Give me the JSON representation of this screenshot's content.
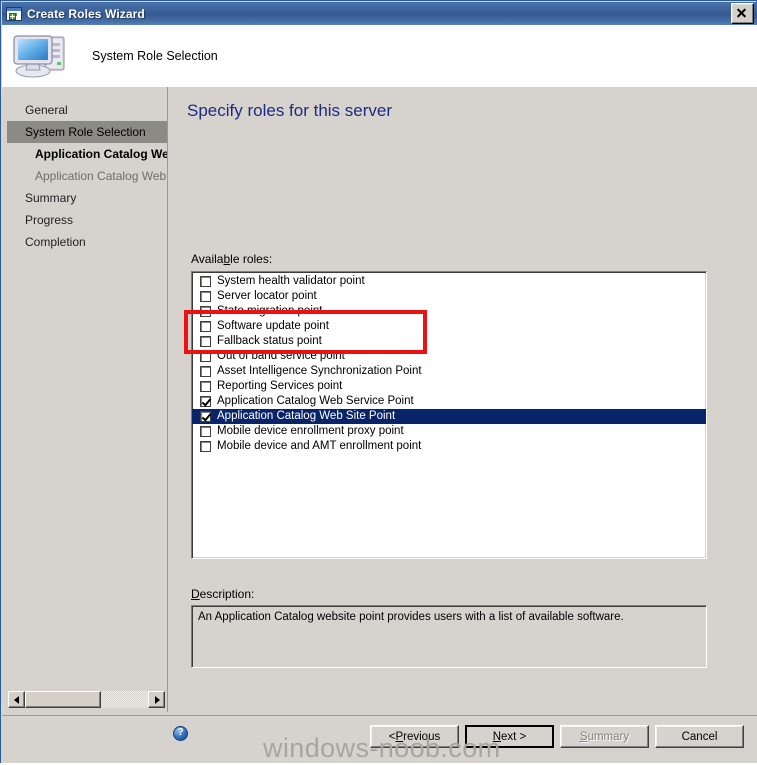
{
  "window": {
    "title": "Create Roles Wizard",
    "icon": "wizard-window-icon",
    "close_label": "Close"
  },
  "header": {
    "title": "System Role Selection",
    "icon": "computer-icon"
  },
  "sidebar": {
    "items": [
      {
        "label": "General",
        "state": "normal",
        "level": 0
      },
      {
        "label": "System Role Selection",
        "state": "selected",
        "level": 0
      },
      {
        "label": "Application Catalog Web Se",
        "state": "active",
        "level": 1
      },
      {
        "label": "Application Catalog Web Sit",
        "state": "dim",
        "level": 1
      },
      {
        "label": "Summary",
        "state": "normal",
        "level": 0
      },
      {
        "label": "Progress",
        "state": "normal",
        "level": 0
      },
      {
        "label": "Completion",
        "state": "normal",
        "level": 0
      }
    ],
    "scrollbar": {
      "left_arrow": "scroll-left",
      "right_arrow": "scroll-right"
    }
  },
  "content": {
    "heading": "Specify roles for this server",
    "roles_label_pre": "Availa",
    "roles_label_accel": "b",
    "roles_label_post": "le roles:",
    "description_label_accel": "D",
    "description_label_post": "escription:",
    "description_text": "An Application Catalog website point provides users with a list of available software.",
    "roles": [
      {
        "label": "System health validator point",
        "checked": false,
        "selected": false
      },
      {
        "label": "Server locator point",
        "checked": false,
        "selected": false
      },
      {
        "label": "State migration point",
        "checked": false,
        "selected": false
      },
      {
        "label": "Software update point",
        "checked": false,
        "selected": false
      },
      {
        "label": "Fallback status point",
        "checked": false,
        "selected": false
      },
      {
        "label": "Out of band service point",
        "checked": false,
        "selected": false
      },
      {
        "label": "Asset Intelligence Synchronization Point",
        "checked": false,
        "selected": false
      },
      {
        "label": "Reporting Services point",
        "checked": false,
        "selected": false
      },
      {
        "label": "Application Catalog Web Service Point",
        "checked": true,
        "selected": false
      },
      {
        "label": "Application Catalog Web Site Point",
        "checked": true,
        "selected": true
      },
      {
        "label": "Mobile device enrollment proxy point",
        "checked": false,
        "selected": false
      },
      {
        "label": "Mobile device and AMT enrollment point",
        "checked": false,
        "selected": false
      }
    ]
  },
  "footer": {
    "help_icon": "help-icon",
    "help_glyph": "?",
    "buttons": [
      {
        "name": "previous",
        "pre": "< ",
        "accel": "P",
        "post": "revious",
        "state": "enabled"
      },
      {
        "name": "next",
        "pre": "",
        "accel": "N",
        "post": "ext >",
        "state": "default"
      },
      {
        "name": "summary",
        "pre": "",
        "accel": "S",
        "post": "ummary",
        "state": "disabled"
      },
      {
        "name": "cancel",
        "pre": "",
        "accel": "",
        "post": "Cancel",
        "state": "enabled"
      }
    ]
  },
  "watermark": {
    "text": "windows-noob.com"
  },
  "annotation": {
    "type": "red-rectangle-highlight",
    "color": "#ee1111"
  },
  "colors": {
    "titlebar_blue": "#3a5f97",
    "heading_blue": "#1f2b80",
    "selection_blue": "#0a246a",
    "dialog_face": "#d6d3ce",
    "nav_selected": "#8c8a85",
    "annotation_red": "#ee1111"
  }
}
